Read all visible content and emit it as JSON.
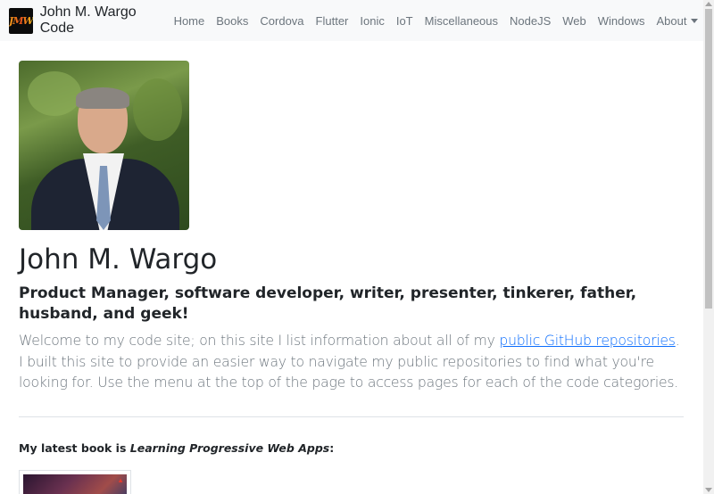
{
  "navbar": {
    "brand_logo_text": "JMW",
    "brand_name": "John M. Wargo Code",
    "items": [
      {
        "label": "Home"
      },
      {
        "label": "Books"
      },
      {
        "label": "Cordova"
      },
      {
        "label": "Flutter"
      },
      {
        "label": "Ionic"
      },
      {
        "label": "IoT"
      },
      {
        "label": "Miscellaneous"
      },
      {
        "label": "NodeJS"
      },
      {
        "label": "Web"
      },
      {
        "label": "Windows"
      },
      {
        "label": "About"
      }
    ]
  },
  "profile": {
    "name": "John M. Wargo",
    "tagline": "Product Manager, software developer, writer, presenter, tinkerer, father, husband, and geek!",
    "intro_before_link": "Welcome to my code site; on this site I list information about all of my ",
    "intro_link": "public GitHub repositories",
    "intro_after_link": ". I built this site to provide an easier way to navigate my public repositories to find what you're looking for. Use the menu at the top of the page to access pages for each of the code categories."
  },
  "latest_book": {
    "prefix": "My latest book is ",
    "title": "Learning Progressive Web Apps",
    "suffix": ":"
  },
  "colors": {
    "navbar_bg": "#f8f9fa",
    "nav_link": "#6c757d",
    "link": "#0d6efd",
    "text": "#212529"
  }
}
